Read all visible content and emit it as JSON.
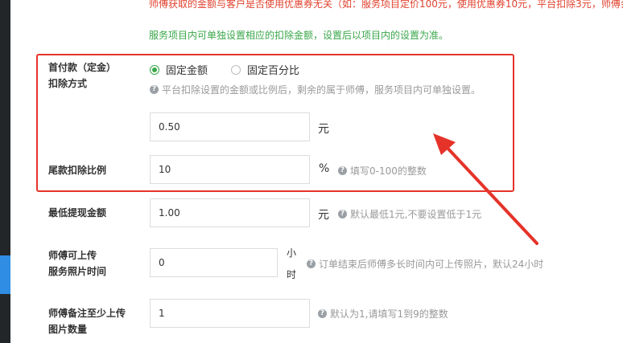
{
  "notices": {
    "red_line": "师傅获取的金额与客户是否使用优惠券无关（如：服务项目定价100元，使用优惠券10元，平台扣除3元，师傅会",
    "green_line": "服务项目内可单独设置相应的扣除金额，设置后以项目内的设置为准。"
  },
  "deposit": {
    "label_line1": "首付款（定金）",
    "label_line2": "扣除方式",
    "option_fixed": "固定金额",
    "option_percent": "固定百分比",
    "selected": "固定金额",
    "help": "平台扣除设置的金额或比例后，剩余的属于师傅，服务项目内可单独设置。",
    "amount_value": "0.50",
    "amount_unit": "元"
  },
  "final_payment": {
    "label": "尾款扣除比例",
    "value": "10",
    "unit": "%",
    "help": "填写0-100的整数"
  },
  "min_withdraw": {
    "label": "最低提现金额",
    "value": "1.00",
    "unit": "元",
    "help": "默认最低1元,不要设置低于1元"
  },
  "upload_time": {
    "label_line1": "师傅可上传",
    "label_line2": "服务照片时间",
    "value": "0",
    "unit_line1": "小",
    "unit_line2": "时",
    "help": "订单结束后师傅多长时间内可上传照片，默认24小时"
  },
  "min_photos": {
    "label_line1": "师傅备注至少上传",
    "label_line2": "图片数量",
    "value": "1",
    "help": "默认为1,请填写1到9的整数"
  },
  "colors": {
    "highlight_box": "#e5332a",
    "accent_green": "#3aa64a",
    "sidebar": "#232629"
  }
}
